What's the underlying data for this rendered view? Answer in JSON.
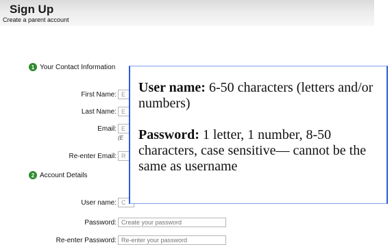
{
  "header": {
    "title": "Sign Up",
    "subtitle": "Create a parent account"
  },
  "sections": {
    "contact": {
      "number": "1",
      "title": "Your Contact Information"
    },
    "account": {
      "number": "2",
      "title": "Account Details"
    }
  },
  "contact_fields": {
    "first_name": {
      "label": "First Name:",
      "value": "E"
    },
    "last_name": {
      "label": "Last Name:",
      "value": "E"
    },
    "email": {
      "label": "Email:",
      "value": "E",
      "hint": "(E"
    },
    "reenter_email": {
      "label": "Re-enter Email:",
      "value": "R"
    }
  },
  "account_fields": {
    "username": {
      "label": "User name:",
      "value": "C"
    },
    "password": {
      "label": "Password:",
      "placeholder": "Create your password"
    },
    "reenter_password": {
      "label": "Re-enter Password:",
      "placeholder": "Re-enter your password"
    }
  },
  "overlay": {
    "username_title": "User name:",
    "username_text": " 6-50 characters (letters and/or numbers)",
    "password_title": "Password:",
    "password_text": " 1 letter, 1 number, 8-50 characters, case sensitive— cannot be the same as username"
  },
  "colors": {
    "step_badge": "#2e8b2e",
    "overlay_border": "#2a5bd7"
  }
}
